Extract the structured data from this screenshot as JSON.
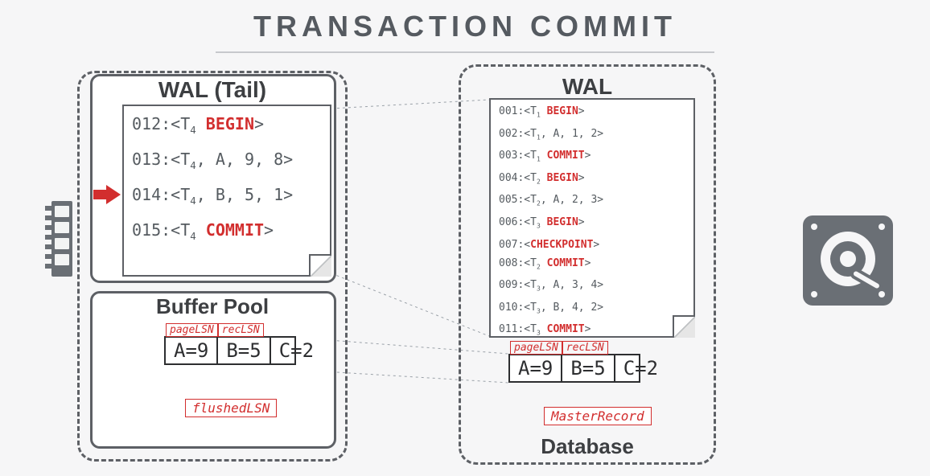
{
  "title": "TRANSACTION COMMIT",
  "left": {
    "wal_title": "WAL (Tail)",
    "lines": {
      "l1_lsn": "012",
      "l1_t": "T",
      "l1_sub": "4",
      "l1_kw": "BEGIN",
      "l2_lsn": "013",
      "l2_t": "T",
      "l2_sub": "4",
      "l2_rest": ", A, 9, 8>",
      "l3_lsn": "014",
      "l3_t": "T",
      "l3_sub": "4",
      "l3_rest": ", B, 5, 1>",
      "l4_lsn": "015",
      "l4_t": "T",
      "l4_sub": "4",
      "l4_kw": "COMMIT"
    },
    "buffer_title": "Buffer Pool",
    "hdr1": "pageLSN",
    "hdr2": "recLSN",
    "c1": "A=9",
    "c2": "B=5",
    "c3": "C=2",
    "flushed": "flushedLSN"
  },
  "right": {
    "wal_title": "WAL",
    "w": {
      "a1": "001",
      "a2": "002",
      "a3": "003",
      "a4": "004",
      "a5": "005",
      "a6": "006",
      "a7": "007",
      "a8": "008",
      "a9": "009",
      "a10": "010",
      "a11": "011",
      "t1s": "1",
      "t2s": "1",
      "t3s": "1",
      "t4s": "2",
      "t5s": "2",
      "t6s": "3",
      "t8s": "2",
      "t9s": "3",
      "t10s": "3",
      "t11s": "3",
      "r2": ", A, 1, 2>",
      "r5": ", A, 2, 3>",
      "r9": ", A, 3, 4>",
      "r10": ", B, 4, 2>",
      "kw_begin": "BEGIN",
      "kw_commit": "COMMIT",
      "kw_chk": "CHECKPOINT"
    },
    "hdr1": "pageLSN",
    "hdr2": "recLSN",
    "c1": "A=9",
    "c2": "B=5",
    "c3": "C=2",
    "master": "MasterRecord",
    "db_title": "Database"
  }
}
